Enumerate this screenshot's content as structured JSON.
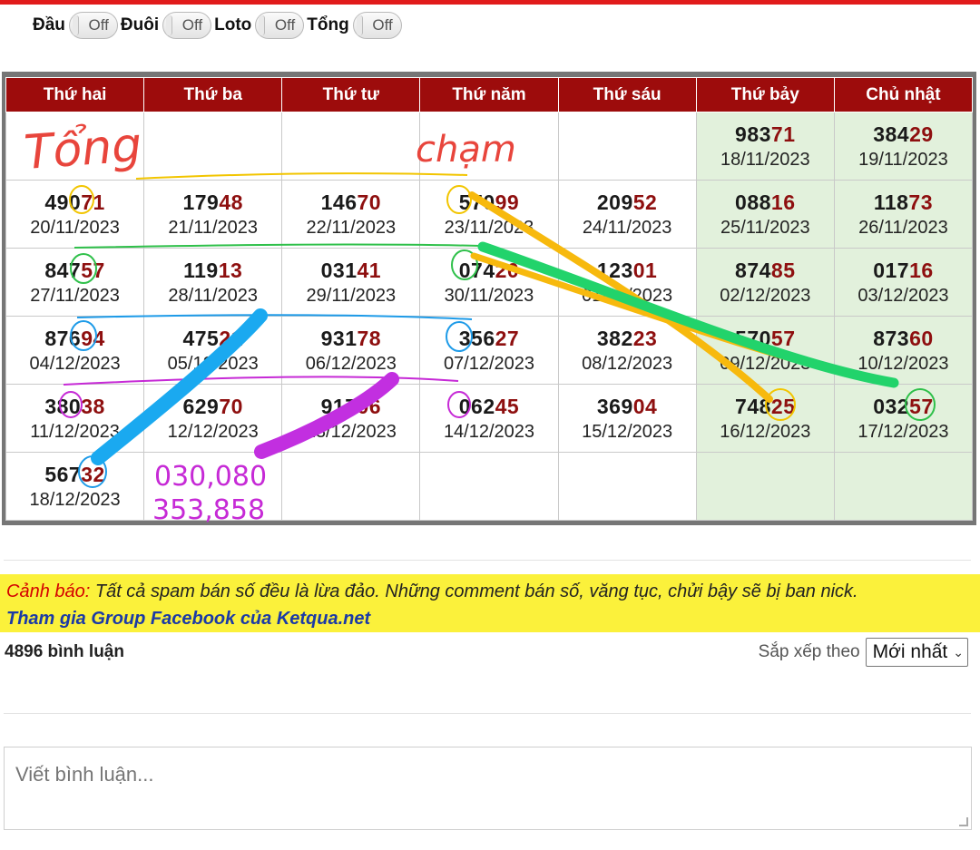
{
  "toggles": [
    {
      "label": "Đầu",
      "state": "Off"
    },
    {
      "label": "Đuôi",
      "state": "Off"
    },
    {
      "label": "Loto",
      "state": "Off"
    },
    {
      "label": "Tổng",
      "state": "Off"
    }
  ],
  "calendar": {
    "headers": [
      "Thứ hai",
      "Thứ ba",
      "Thứ tư",
      "Thứ năm",
      "Thứ sáu",
      "Thứ bảy",
      "Chủ nhật"
    ],
    "rows": [
      [
        null,
        null,
        null,
        null,
        null,
        {
          "head": "983",
          "tail": "71",
          "date": "18/11/2023"
        },
        {
          "head": "384",
          "tail": "29",
          "date": "19/11/2023"
        }
      ],
      [
        {
          "head": "490",
          "tail": "71",
          "date": "20/11/2023"
        },
        {
          "head": "179",
          "tail": "48",
          "date": "21/11/2023"
        },
        {
          "head": "146",
          "tail": "70",
          "date": "22/11/2023"
        },
        {
          "head": "570",
          "tail": "99",
          "date": "23/11/2023"
        },
        {
          "head": "209",
          "tail": "52",
          "date": "24/11/2023"
        },
        {
          "head": "088",
          "tail": "16",
          "date": "25/11/2023"
        },
        {
          "head": "118",
          "tail": "73",
          "date": "26/11/2023"
        }
      ],
      [
        {
          "head": "847",
          "tail": "57",
          "date": "27/11/2023"
        },
        {
          "head": "119",
          "tail": "13",
          "date": "28/11/2023"
        },
        {
          "head": "031",
          "tail": "41",
          "date": "29/11/2023"
        },
        {
          "head": "074",
          "tail": "20",
          "date": "30/11/2023"
        },
        {
          "head": "123",
          "tail": "01",
          "date": "01/12/2023"
        },
        {
          "head": "874",
          "tail": "85",
          "date": "02/12/2023"
        },
        {
          "head": "017",
          "tail": "16",
          "date": "03/12/2023"
        }
      ],
      [
        {
          "head": "876",
          "tail": "94",
          "date": "04/12/2023"
        },
        {
          "head": "475",
          "tail": "21",
          "date": "05/12/2023"
        },
        {
          "head": "931",
          "tail": "78",
          "date": "06/12/2023"
        },
        {
          "head": "356",
          "tail": "27",
          "date": "07/12/2023"
        },
        {
          "head": "382",
          "tail": "23",
          "date": "08/12/2023"
        },
        {
          "head": "570",
          "tail": "57",
          "date": "09/12/2023"
        },
        {
          "head": "873",
          "tail": "60",
          "date": "10/12/2023"
        }
      ],
      [
        {
          "head": "380",
          "tail": "38",
          "date": "11/12/2023"
        },
        {
          "head": "629",
          "tail": "70",
          "date": "12/12/2023"
        },
        {
          "head": "917",
          "tail": "06",
          "date": "13/12/2023"
        },
        {
          "head": "062",
          "tail": "45",
          "date": "14/12/2023"
        },
        {
          "head": "369",
          "tail": "04",
          "date": "15/12/2023"
        },
        {
          "head": "748",
          "tail": "25",
          "date": "16/12/2023"
        },
        {
          "head": "032",
          "tail": "57",
          "date": "17/12/2023"
        }
      ],
      [
        {
          "head": "567",
          "tail": "32",
          "date": "18/12/2023"
        },
        null,
        null,
        null,
        null,
        null,
        null
      ]
    ]
  },
  "annotations": {
    "tong": "Tổng",
    "cham": "chạm",
    "numbers_line1": "030,080",
    "numbers_line2": "353,858"
  },
  "warning": {
    "label": "Cảnh báo:",
    "text": " Tất cả spam bán số đều là lừa đảo. Những comment bán số, văng tục, chửi bậy sẽ bị ban nick.",
    "link": "Tham gia Group Facebook của Ketqua.net"
  },
  "comments": {
    "count_text": "4896 bình luận",
    "sort_label": "Sắp xếp theo",
    "sort_value": "Mới nhất",
    "input_placeholder": "Viết bình luận..."
  },
  "colors": {
    "header_bg": "#9d0c0c",
    "tail_digits": "#8e0f0f",
    "weekend_bg": "#e2f1dc",
    "warning_bg": "#fbf13b",
    "warning_label": "#d40000",
    "link": "#1b3aa6"
  }
}
